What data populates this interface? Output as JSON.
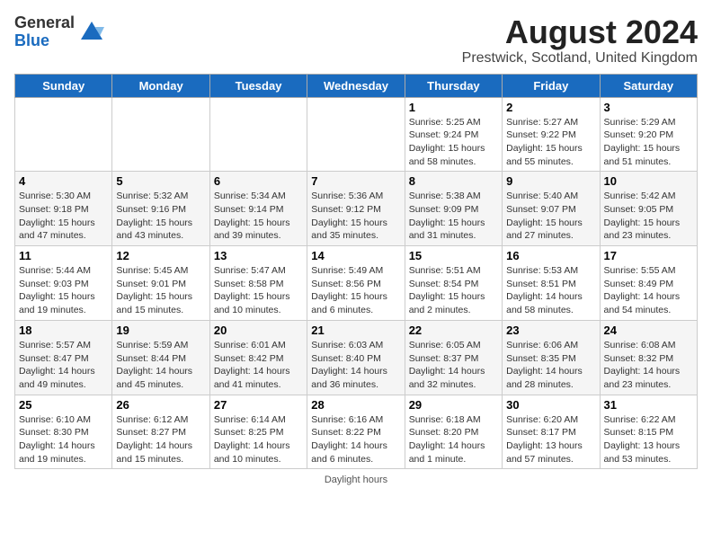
{
  "header": {
    "logo_general": "General",
    "logo_blue": "Blue",
    "month_year": "August 2024",
    "location": "Prestwick, Scotland, United Kingdom"
  },
  "days_of_week": [
    "Sunday",
    "Monday",
    "Tuesday",
    "Wednesday",
    "Thursday",
    "Friday",
    "Saturday"
  ],
  "weeks": [
    [
      {
        "day": "",
        "info": ""
      },
      {
        "day": "",
        "info": ""
      },
      {
        "day": "",
        "info": ""
      },
      {
        "day": "",
        "info": ""
      },
      {
        "day": "1",
        "info": "Sunrise: 5:25 AM\nSunset: 9:24 PM\nDaylight: 15 hours\nand 58 minutes."
      },
      {
        "day": "2",
        "info": "Sunrise: 5:27 AM\nSunset: 9:22 PM\nDaylight: 15 hours\nand 55 minutes."
      },
      {
        "day": "3",
        "info": "Sunrise: 5:29 AM\nSunset: 9:20 PM\nDaylight: 15 hours\nand 51 minutes."
      }
    ],
    [
      {
        "day": "4",
        "info": "Sunrise: 5:30 AM\nSunset: 9:18 PM\nDaylight: 15 hours\nand 47 minutes."
      },
      {
        "day": "5",
        "info": "Sunrise: 5:32 AM\nSunset: 9:16 PM\nDaylight: 15 hours\nand 43 minutes."
      },
      {
        "day": "6",
        "info": "Sunrise: 5:34 AM\nSunset: 9:14 PM\nDaylight: 15 hours\nand 39 minutes."
      },
      {
        "day": "7",
        "info": "Sunrise: 5:36 AM\nSunset: 9:12 PM\nDaylight: 15 hours\nand 35 minutes."
      },
      {
        "day": "8",
        "info": "Sunrise: 5:38 AM\nSunset: 9:09 PM\nDaylight: 15 hours\nand 31 minutes."
      },
      {
        "day": "9",
        "info": "Sunrise: 5:40 AM\nSunset: 9:07 PM\nDaylight: 15 hours\nand 27 minutes."
      },
      {
        "day": "10",
        "info": "Sunrise: 5:42 AM\nSunset: 9:05 PM\nDaylight: 15 hours\nand 23 minutes."
      }
    ],
    [
      {
        "day": "11",
        "info": "Sunrise: 5:44 AM\nSunset: 9:03 PM\nDaylight: 15 hours\nand 19 minutes."
      },
      {
        "day": "12",
        "info": "Sunrise: 5:45 AM\nSunset: 9:01 PM\nDaylight: 15 hours\nand 15 minutes."
      },
      {
        "day": "13",
        "info": "Sunrise: 5:47 AM\nSunset: 8:58 PM\nDaylight: 15 hours\nand 10 minutes."
      },
      {
        "day": "14",
        "info": "Sunrise: 5:49 AM\nSunset: 8:56 PM\nDaylight: 15 hours\nand 6 minutes."
      },
      {
        "day": "15",
        "info": "Sunrise: 5:51 AM\nSunset: 8:54 PM\nDaylight: 15 hours\nand 2 minutes."
      },
      {
        "day": "16",
        "info": "Sunrise: 5:53 AM\nSunset: 8:51 PM\nDaylight: 14 hours\nand 58 minutes."
      },
      {
        "day": "17",
        "info": "Sunrise: 5:55 AM\nSunset: 8:49 PM\nDaylight: 14 hours\nand 54 minutes."
      }
    ],
    [
      {
        "day": "18",
        "info": "Sunrise: 5:57 AM\nSunset: 8:47 PM\nDaylight: 14 hours\nand 49 minutes."
      },
      {
        "day": "19",
        "info": "Sunrise: 5:59 AM\nSunset: 8:44 PM\nDaylight: 14 hours\nand 45 minutes."
      },
      {
        "day": "20",
        "info": "Sunrise: 6:01 AM\nSunset: 8:42 PM\nDaylight: 14 hours\nand 41 minutes."
      },
      {
        "day": "21",
        "info": "Sunrise: 6:03 AM\nSunset: 8:40 PM\nDaylight: 14 hours\nand 36 minutes."
      },
      {
        "day": "22",
        "info": "Sunrise: 6:05 AM\nSunset: 8:37 PM\nDaylight: 14 hours\nand 32 minutes."
      },
      {
        "day": "23",
        "info": "Sunrise: 6:06 AM\nSunset: 8:35 PM\nDaylight: 14 hours\nand 28 minutes."
      },
      {
        "day": "24",
        "info": "Sunrise: 6:08 AM\nSunset: 8:32 PM\nDaylight: 14 hours\nand 23 minutes."
      }
    ],
    [
      {
        "day": "25",
        "info": "Sunrise: 6:10 AM\nSunset: 8:30 PM\nDaylight: 14 hours\nand 19 minutes."
      },
      {
        "day": "26",
        "info": "Sunrise: 6:12 AM\nSunset: 8:27 PM\nDaylight: 14 hours\nand 15 minutes."
      },
      {
        "day": "27",
        "info": "Sunrise: 6:14 AM\nSunset: 8:25 PM\nDaylight: 14 hours\nand 10 minutes."
      },
      {
        "day": "28",
        "info": "Sunrise: 6:16 AM\nSunset: 8:22 PM\nDaylight: 14 hours\nand 6 minutes."
      },
      {
        "day": "29",
        "info": "Sunrise: 6:18 AM\nSunset: 8:20 PM\nDaylight: 14 hours\nand 1 minute."
      },
      {
        "day": "30",
        "info": "Sunrise: 6:20 AM\nSunset: 8:17 PM\nDaylight: 13 hours\nand 57 minutes."
      },
      {
        "day": "31",
        "info": "Sunrise: 6:22 AM\nSunset: 8:15 PM\nDaylight: 13 hours\nand 53 minutes."
      }
    ]
  ],
  "footer": {
    "daylight_hours_label": "Daylight hours"
  }
}
